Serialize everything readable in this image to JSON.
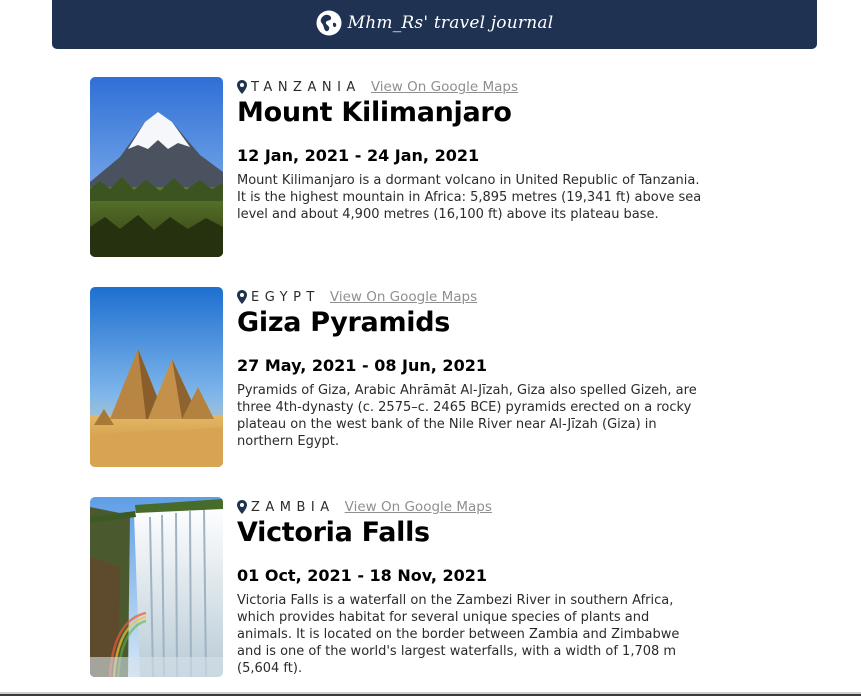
{
  "header": {
    "brand_text": "Mhm_Rs' travel journal",
    "icon": "globe-icon",
    "background": "#1f3251"
  },
  "entries": [
    {
      "country": "TANZANIA",
      "maps_link": "View On Google Maps",
      "title": "Mount Kilimanjaro",
      "dates": "12 Jan, 2021 - 24 Jan, 2021",
      "description": "Mount Kilimanjaro is a dormant volcano in United Republic of Tanzania. It is the highest mountain in Africa: 5,895 metres (19,341 ft) above sea level and about 4,900 metres (16,100 ft) above its plateau base.",
      "image": "mountain-photo"
    },
    {
      "country": "EGYPT",
      "maps_link": "View On Google Maps",
      "title": "Giza Pyramids",
      "dates": "27 May, 2021 - 08 Jun, 2021",
      "description": "Pyramids of Giza, Arabic Ahrāmāt Al-Jīzah, Giza also spelled Gizeh, are three 4th-dynasty (c. 2575–c. 2465 BCE) pyramids erected on a rocky plateau on the west bank of the Nile River near Al-Jīzah (Giza) in northern Egypt.",
      "image": "pyramids-photo"
    },
    {
      "country": "ZAMBIA",
      "maps_link": "View On Google Maps",
      "title": "Victoria Falls",
      "dates": "01 Oct, 2021 - 18 Nov, 2021",
      "description": "Victoria Falls is a waterfall on the Zambezi River in southern Africa, which provides habitat for several unique species of plants and animals. It is located on the border between Zambia and Zimbabwe and is one of the world's largest waterfalls, with a width of 1,708 m (5,604 ft).",
      "image": "waterfall-photo"
    }
  ]
}
